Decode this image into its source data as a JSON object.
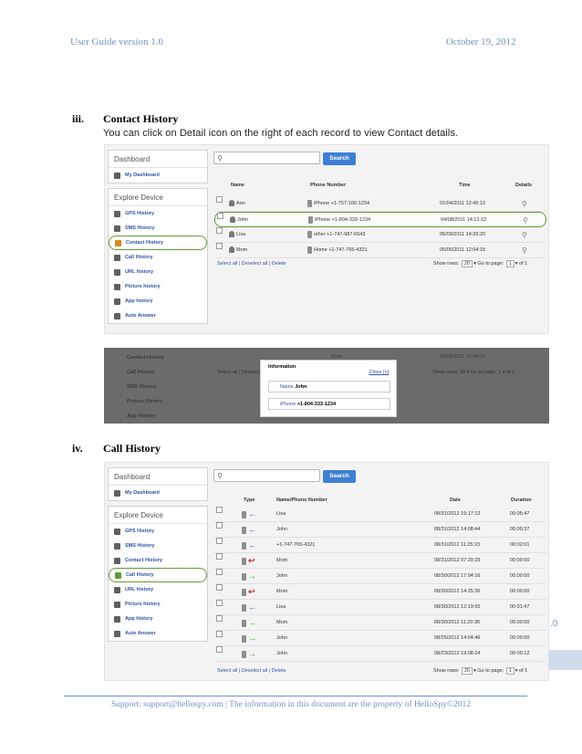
{
  "header": {
    "left": "User Guide version 1.0",
    "right": "October 19, 2012"
  },
  "sec3": {
    "num": "iii.",
    "title": "Contact History",
    "desc": "You can click on Detail icon on the right of each record to view Contact details."
  },
  "sec4": {
    "num": "iv.",
    "title": "Call History"
  },
  "sidebar": {
    "dashboard": "Dashboard",
    "my_dashboard": "My Dashboard",
    "explore": "Explore Device",
    "items": [
      "GPS History",
      "SMS History",
      "Contact History",
      "Call History",
      "URL history",
      "Picture history",
      "App history",
      "Auto Answer"
    ]
  },
  "search_label": "Search",
  "contact_table": {
    "headers": [
      "Name",
      "Phone Number",
      "Time",
      "Details"
    ],
    "rows": [
      {
        "name": "Ann",
        "phone": "iPhone +1-757-100-1234",
        "time": "01/04/2011 12:45:12"
      },
      {
        "name": "John",
        "phone": "iPhone +1-804-333-1234",
        "time": "04/08/2011 14:12:12"
      },
      {
        "name": "Lisa",
        "phone": "other +1-747-987-6543",
        "time": "05/09/2011 14:26:20"
      },
      {
        "name": "Mom",
        "phone": "Home +1-747-765-4321",
        "time": "05/06/2011 12:04:15"
      }
    ]
  },
  "footer_links": "Select all | Deselect all | Delete",
  "pager": {
    "show_rows": "Show rows:",
    "rows_value": "20",
    "go_to": "Go to page:",
    "page_value": "1",
    "of": "of 1"
  },
  "overlay": {
    "items": [
      "Contact History",
      "Call History",
      "SMS History",
      "Picture History",
      "App History"
    ],
    "row_name": "Mom",
    "row_time": "05/06/2011 12:04:15",
    "links": "Select all | Deselect all",
    "popup_title": "Information",
    "popup_close": "Close [x]",
    "name_label": "Name",
    "name_value": "John",
    "phone_label": "iPhone",
    "phone_value": "+1-804-333-1234"
  },
  "call_table": {
    "headers": [
      "Type",
      "Name/Phone Number",
      "Date",
      "Duration"
    ],
    "rows": [
      {
        "dir": "in",
        "name": "Lisa",
        "date": "08/31/2012 19:17:12",
        "dur": "00:05:47"
      },
      {
        "dir": "in",
        "name": "John",
        "date": "08/31/2012 14:08:44",
        "dur": "00:00:37"
      },
      {
        "dir": "in",
        "name": "+1-747-765-4321",
        "date": "08/31/2012 11:25:23",
        "dur": "00:02:01"
      },
      {
        "dir": "missed",
        "name": "Mom",
        "date": "08/31/2012 07:20:29",
        "dur": "00:00:00"
      },
      {
        "dir": "out",
        "name": "John",
        "date": "08/30/2012 17:04:16",
        "dur": "00:00:00"
      },
      {
        "dir": "missed",
        "name": "Mom",
        "date": "08/30/2012 14:25:36",
        "dur": "00:00:00"
      },
      {
        "dir": "in",
        "name": "Lisa",
        "date": "08/30/2012 12:19:55",
        "dur": "00:01:47"
      },
      {
        "dir": "out",
        "name": "Mom",
        "date": "08/30/2012 11:20:36",
        "dur": "00:00:00"
      },
      {
        "dir": "out",
        "name": "John",
        "date": "08/25/2012 14:04:46",
        "dur": "00:00:00"
      },
      {
        "dir": "out",
        "name": "John",
        "date": "08/23/2012 19:08:24",
        "dur": "00:00:12"
      }
    ]
  },
  "edge_text": ".0",
  "footer": "Support: support@hellospy.com | The information in this document are the property of HelloSpy©2012"
}
